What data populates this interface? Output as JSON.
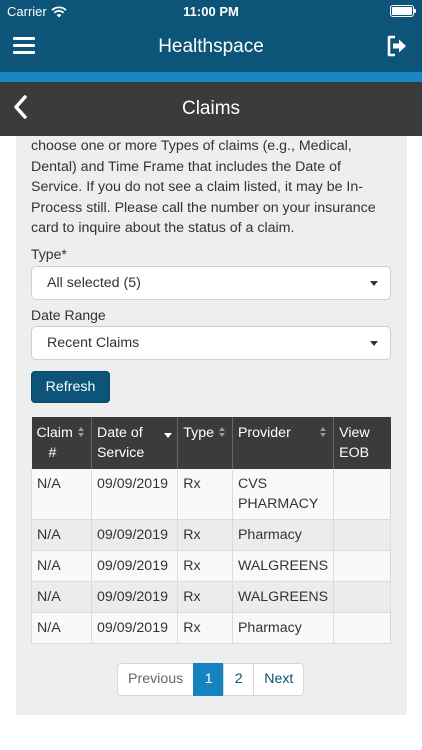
{
  "status_bar": {
    "carrier": "Carrier",
    "time": "11:00 PM"
  },
  "header": {
    "title": "Healthspace"
  },
  "subheader": {
    "title": "Claims"
  },
  "intro_text": "choose one or more Types of claims (e.g., Medical, Dental) and Time Frame that includes the Date of Service. If you do not see a claim listed, it may be In-Process still. Please call the number on your insurance card to inquire about the status of a claim.",
  "filters": {
    "type_label": "Type*",
    "type_value": "All selected (5)",
    "date_range_label": "Date Range",
    "date_range_value": "Recent Claims",
    "refresh_label": "Refresh"
  },
  "table": {
    "columns": [
      "Claim #",
      "Date of Service",
      "Type",
      "Provider",
      "View EOB"
    ],
    "rows": [
      [
        "N/A",
        "09/09/2019",
        "Rx",
        "CVS PHARMACY",
        ""
      ],
      [
        "N/A",
        "09/09/2019",
        "Rx",
        "Pharmacy",
        ""
      ],
      [
        "N/A",
        "09/09/2019",
        "Rx",
        "WALGREENS",
        ""
      ],
      [
        "N/A",
        "09/09/2019",
        "Rx",
        "WALGREENS",
        ""
      ],
      [
        "N/A",
        "09/09/2019",
        "Rx",
        "Pharmacy",
        ""
      ]
    ]
  },
  "pagination": {
    "previous": "Previous",
    "pages": [
      "1",
      "2"
    ],
    "current": "1",
    "next": "Next"
  },
  "colors": {
    "primary": "#0c5478",
    "accent": "#1b86c6",
    "subheader": "#3b3b3b",
    "panel": "#eeeeee"
  },
  "icons": {
    "menu": "hamburger-menu-icon",
    "logout": "logout-icon",
    "back": "chevron-left-icon",
    "wifi": "wifi-icon",
    "battery": "battery-icon"
  }
}
